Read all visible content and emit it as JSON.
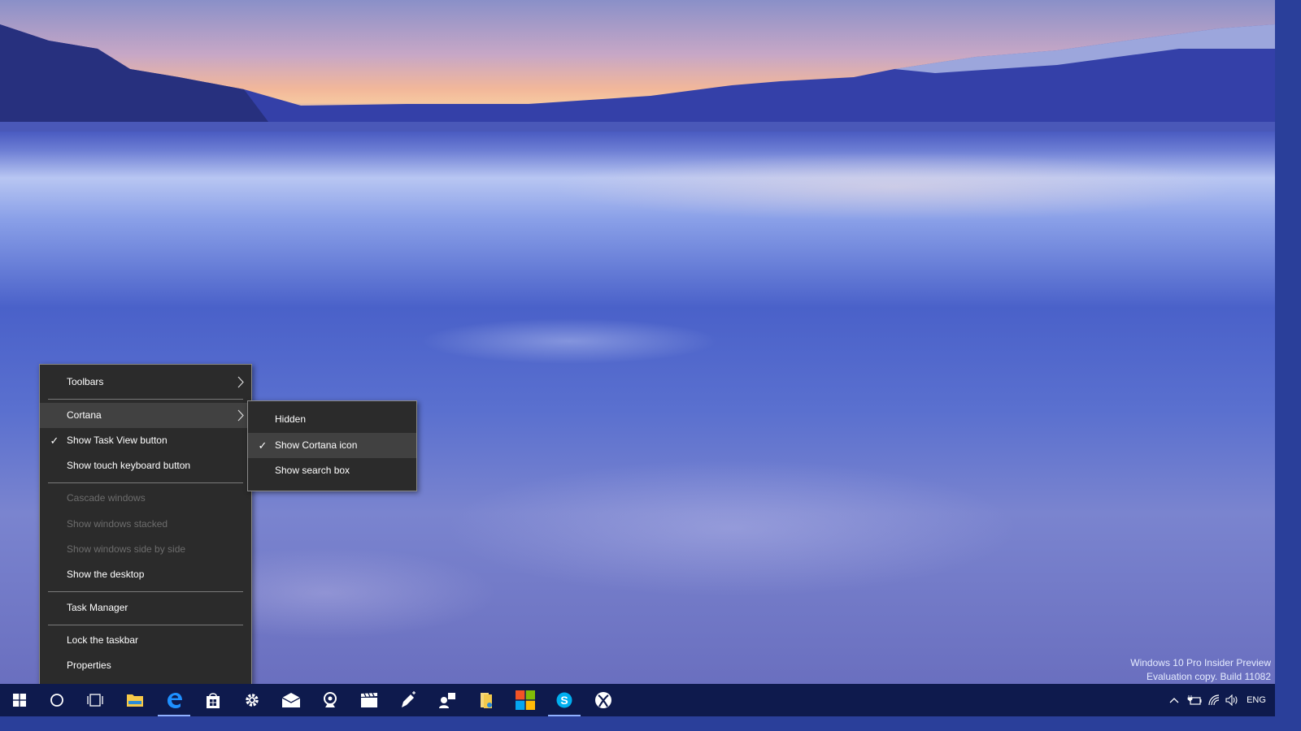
{
  "desktop": {
    "watermark_line1": "Windows 10 Pro Insider Preview",
    "watermark_line2": "Evaluation copy. Build 11082"
  },
  "context_menu": {
    "items": [
      {
        "label": "Toolbars",
        "submenu": true,
        "checked": false,
        "disabled": false
      },
      {
        "label": "Cortana",
        "submenu": true,
        "checked": false,
        "disabled": false,
        "highlighted": true
      },
      {
        "label": "Show Task View button",
        "checked": true,
        "disabled": false
      },
      {
        "label": "Show touch keyboard button",
        "checked": false,
        "disabled": false
      },
      {
        "label": "Cascade windows",
        "checked": false,
        "disabled": true
      },
      {
        "label": "Show windows stacked",
        "checked": false,
        "disabled": true
      },
      {
        "label": "Show windows side by side",
        "checked": false,
        "disabled": true
      },
      {
        "label": "Show the desktop",
        "checked": false,
        "disabled": false
      },
      {
        "label": "Task Manager",
        "checked": false,
        "disabled": false
      },
      {
        "label": "Lock the taskbar",
        "checked": false,
        "disabled": false
      },
      {
        "label": "Properties",
        "checked": false,
        "disabled": false
      }
    ],
    "check_glyph": "✓"
  },
  "cortana_submenu": {
    "items": [
      {
        "label": "Hidden",
        "checked": false
      },
      {
        "label": "Show Cortana icon",
        "checked": true,
        "highlighted": true
      },
      {
        "label": "Show search box",
        "checked": false
      }
    ]
  },
  "taskbar": {
    "pinned": [
      {
        "name": "start",
        "icon": "windows-logo-icon"
      },
      {
        "name": "cortana",
        "icon": "cortana-circle-icon"
      },
      {
        "name": "task-view",
        "icon": "task-view-icon"
      },
      {
        "name": "file-explorer",
        "icon": "folder-icon"
      },
      {
        "name": "edge",
        "icon": "edge-icon",
        "active": true
      },
      {
        "name": "store",
        "icon": "store-bag-icon"
      },
      {
        "name": "settings",
        "icon": "gear-icon"
      },
      {
        "name": "mail",
        "icon": "mail-icon"
      },
      {
        "name": "webcam",
        "icon": "camera-icon"
      },
      {
        "name": "movies",
        "icon": "clapperboard-icon"
      },
      {
        "name": "sketch",
        "icon": "pen-icon"
      },
      {
        "name": "people",
        "icon": "people-icon"
      },
      {
        "name": "file-pdf",
        "icon": "document-folder-icon"
      },
      {
        "name": "microsoft",
        "icon": "microsoft-logo-icon"
      },
      {
        "name": "skype",
        "icon": "skype-icon",
        "active": true
      },
      {
        "name": "xbox",
        "icon": "xbox-icon"
      }
    ],
    "tray": {
      "language": "ENG"
    }
  },
  "colors": {
    "menu_bg": "#2b2b2b",
    "menu_hover": "#414141",
    "menu_disabled_text": "#6d6d6d",
    "taskbar_bg": "#0e1a4d",
    "accent": "#1e90ff"
  }
}
